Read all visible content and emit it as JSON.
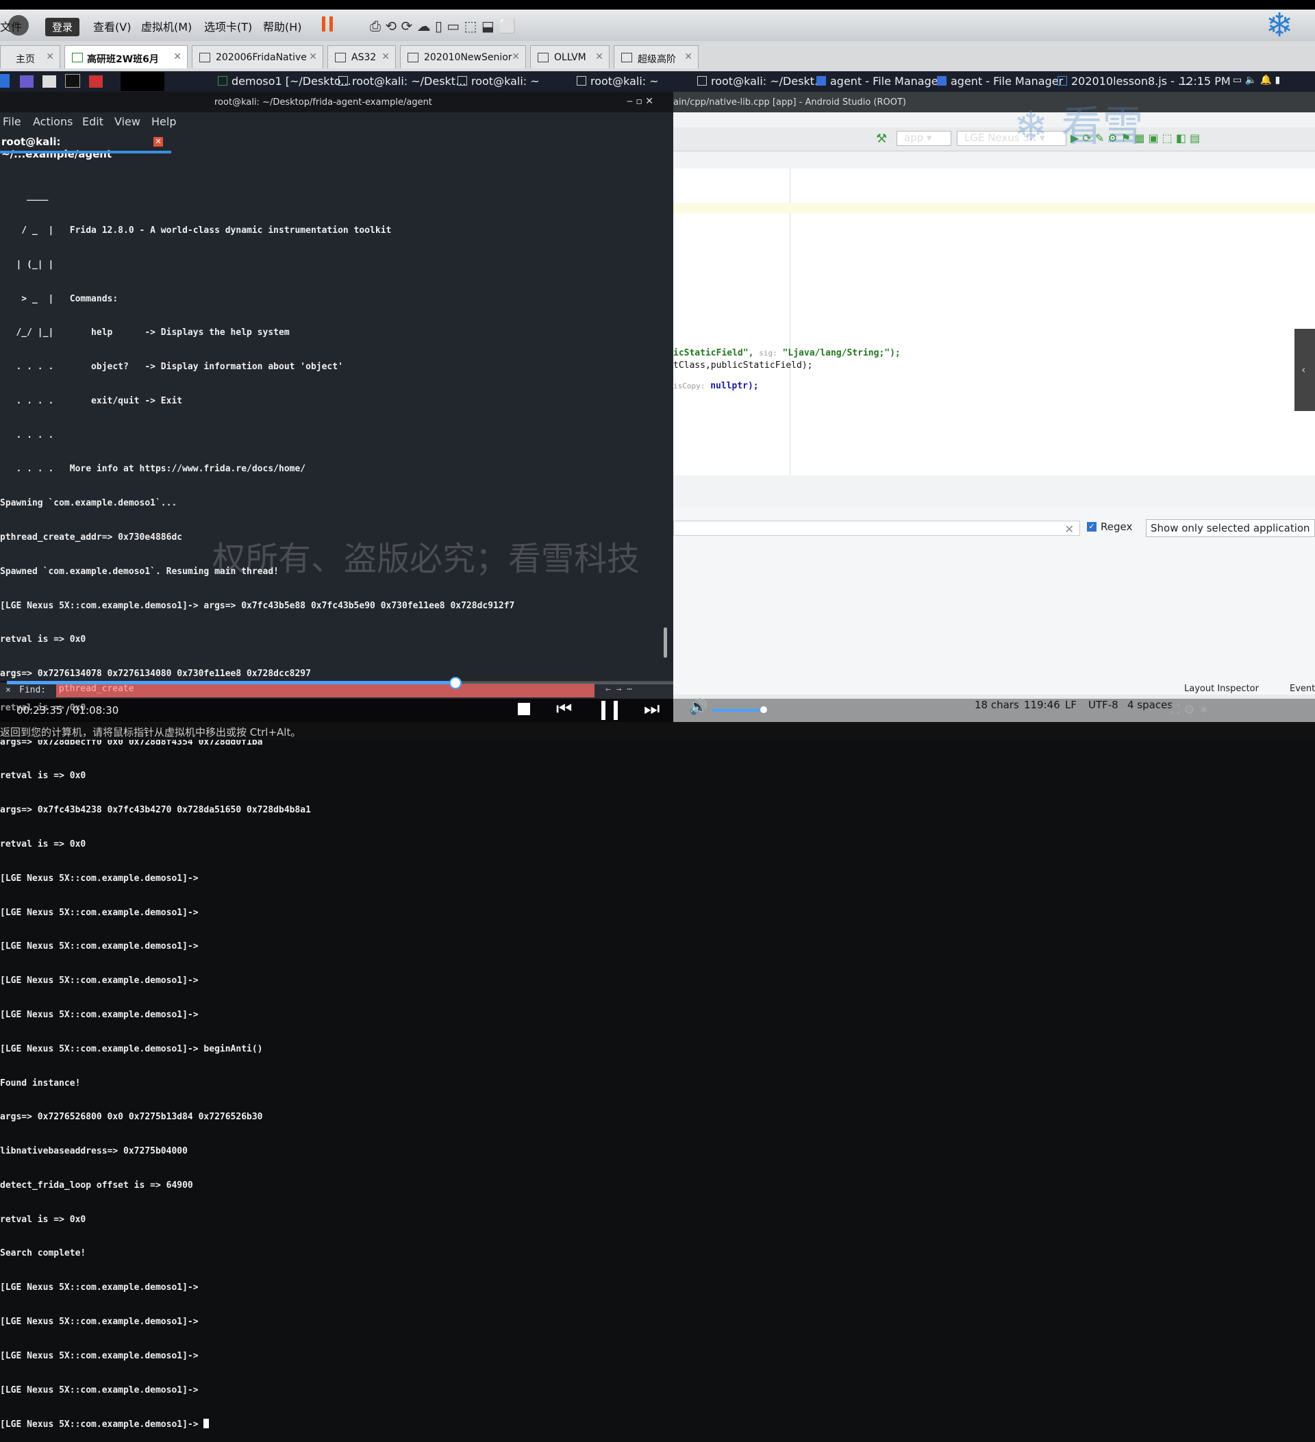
{
  "vm_menu": {
    "login": "登录",
    "items": [
      "文件",
      "查看(V)",
      "虚拟机(M)",
      "选项卡(T)",
      "帮助(H)"
    ]
  },
  "tabs": [
    {
      "label": "主页"
    },
    {
      "label": "高研班2W班6月"
    },
    {
      "label": "202006FridaNative"
    },
    {
      "label": "AS32"
    },
    {
      "label": "202010NewSenior"
    },
    {
      "label": "OLLVM"
    },
    {
      "label": "超级高阶"
    }
  ],
  "taskbar": {
    "items": [
      "demoso1 [~/Deskto...",
      "root@kali: ~/Deskt...",
      "root@kali: ~",
      "root@kali: ~",
      "root@kali: ~/Deskt...",
      "agent - File Manager",
      "agent - File Manager",
      "202010lesson8.js - ..."
    ],
    "time": "12:15 PM"
  },
  "terminal": {
    "title": "root@kali: ~/Desktop/frida-agent-example/agent",
    "menu": [
      "File",
      "Actions",
      "Edit",
      "View",
      "Help"
    ],
    "tab": "root@kali: ~/...example/agent",
    "lines": [
      "     ____",
      "    / _  |   Frida 12.8.0 - A world-class dynamic instrumentation toolkit",
      "   | (_| |",
      "    > _  |   Commands:",
      "   /_/ |_|       help      -> Displays the help system",
      "   . . . .       object?   -> Display information about 'object'",
      "   . . . .       exit/quit -> Exit",
      "   . . . .",
      "   . . . .   More info at https://www.frida.re/docs/home/",
      "Spawning `com.example.demoso1`...",
      "pthread_create_addr=> 0x730e4886dc",
      "Spawned `com.example.demoso1`. Resuming main thread!",
      "[LGE Nexus 5X::com.example.demoso1]-> args=> 0x7fc43b5e88 0x7fc43b5e90 0x730fe11ee8 0x728dc912f7",
      "retval is => 0x0",
      "args=> 0x7276134078 0x7276134080 0x730fe11ee8 0x728dcc8297",
      "retval is => 0x0",
      "args=> 0x728dbecff0 0x0 0x728d8f4354 0x728dd0f1ba",
      "retval is => 0x0",
      "args=> 0x7fc43b4238 0x7fc43b4270 0x728da51650 0x728db4b8a1",
      "retval is => 0x0",
      "[LGE Nexus 5X::com.example.demoso1]->",
      "[LGE Nexus 5X::com.example.demoso1]->",
      "[LGE Nexus 5X::com.example.demoso1]->",
      "[LGE Nexus 5X::com.example.demoso1]->",
      "[LGE Nexus 5X::com.example.demoso1]->",
      "[LGE Nexus 5X::com.example.demoso1]-> beginAnti()",
      "Found instance!",
      "args=> 0x7276526800 0x0 0x7275b13d84 0x7276526b30",
      "libnativebaseaddress=> 0x7275b04000",
      "detect_frida_loop offset is => 64900",
      "retval is => 0x0",
      "Search complete!",
      "[LGE Nexus 5X::com.example.demoso1]->",
      "[LGE Nexus 5X::com.example.demoso1]->",
      "[LGE Nexus 5X::com.example.demoso1]->",
      "[LGE Nexus 5X::com.example.demoso1]->",
      "[LGE Nexus 5X::com.example.demoso1]-> "
    ],
    "find_label": "Find:",
    "find_value": "pthread_create"
  },
  "studio": {
    "title": "ain/cpp/native-lib.cpp [app] - Android Studio (ROOT)",
    "run_config": "app",
    "device": "LGE Nexus 5X",
    "code_line1_a": "icStaticField\",",
    "code_line1_sig": "sig:",
    "code_line1_b": "\"Ljava/lang/String;\");",
    "code_line2": "tClass,publicStaticField);",
    "code_line3_hint": "isCopy:",
    "code_line3": "nullptr);",
    "regex_label": "Regex",
    "filter_value": "Show only selected application",
    "layout_inspector": "Layout Inspector",
    "event": "Event",
    "status": [
      "18 chars",
      "119:46",
      "LF",
      "UTF-8",
      "4 spaces"
    ]
  },
  "player": {
    "time": "00:23:35 / 01:08:30",
    "progress_fraction": 0.344,
    "hint": "返回到您的计算机，请将鼠标指针从虚拟机中移出或按 Ctrl+Alt。",
    "watermark": "权所有、盗版必究；看雪科技",
    "logo_text": "看雪"
  }
}
